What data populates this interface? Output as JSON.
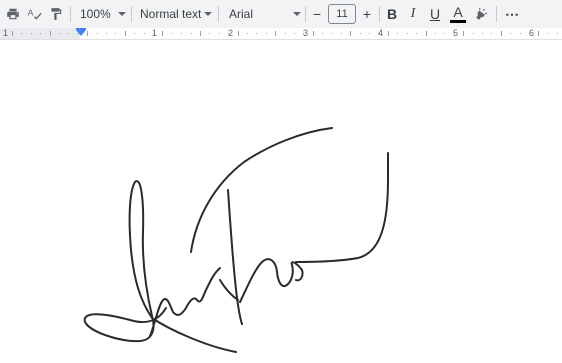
{
  "toolbar": {
    "print_icon": "print-icon",
    "spellcheck_icon": "spellcheck-icon",
    "paint_format_icon": "paint-format-icon",
    "zoom": "100%",
    "style": "Normal text",
    "font": "Arial",
    "font_size": "11",
    "decrease_label": "−",
    "increase_label": "+",
    "bold_label": "B",
    "italic_label": "I",
    "underline_label": "U",
    "text_color_label": "A",
    "highlight_icon": "highlight-pen-icon",
    "more_label": "⋯",
    "text_color_bar": "#000000"
  },
  "ruler": {
    "numbers": [
      "1",
      "1",
      "2",
      "3",
      "4",
      "5",
      "6"
    ],
    "indent_color": "#4285f4"
  },
  "document": {
    "content": "handwritten-signature",
    "ink_color": "#2b2b2b"
  }
}
